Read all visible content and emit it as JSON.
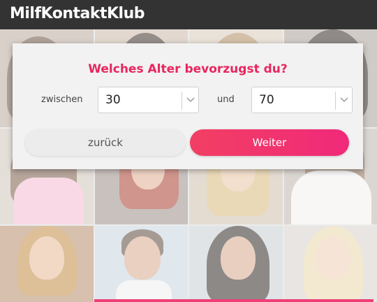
{
  "header": {
    "logo": "MilfKontaktKlub"
  },
  "dialog": {
    "question": "Welches Alter bevorzugst du?",
    "between_label": "zwischen",
    "min_age": "30",
    "and_label": "und",
    "max_age": "70",
    "back_label": "zurück",
    "next_label": "Weiter"
  },
  "colors": {
    "header_bg": "#333333",
    "accent": "#e8265f",
    "button_gradient_start": "#f23f63",
    "button_gradient_end": "#f0297a",
    "card_bg": "#f2f2f2"
  },
  "background_photos": [
    "profile-photo-1",
    "profile-photo-2",
    "profile-photo-3",
    "profile-photo-4",
    "profile-photo-5",
    "profile-photo-6",
    "profile-photo-7",
    "profile-photo-8",
    "profile-photo-9",
    "profile-photo-10",
    "profile-photo-11",
    "profile-photo-12"
  ]
}
